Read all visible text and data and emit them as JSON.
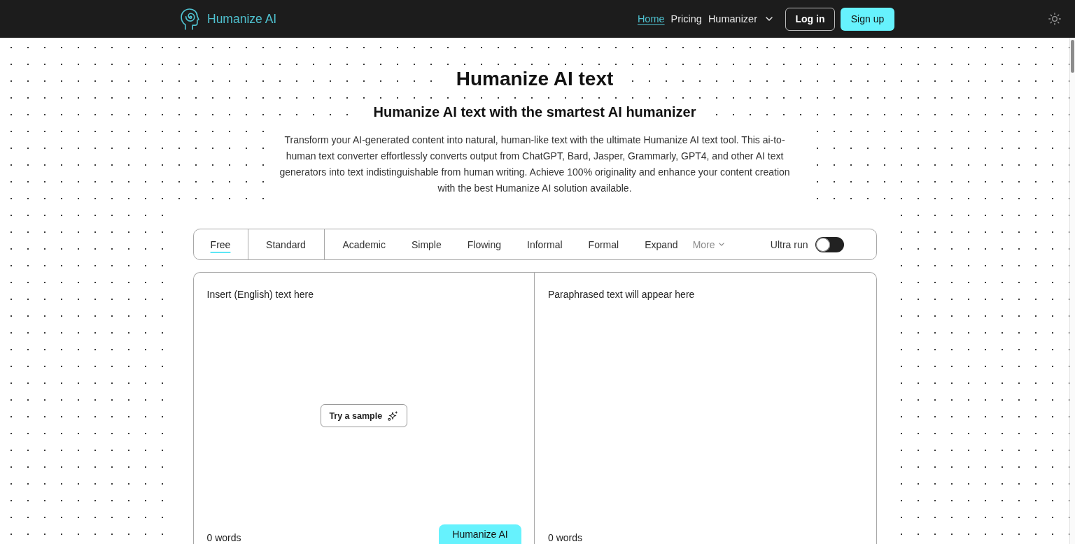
{
  "header": {
    "logo_text": "Humanize AI",
    "nav": [
      {
        "label": "Home",
        "kind": "link",
        "selected": true
      },
      {
        "label": "Pricing",
        "kind": "link",
        "selected": false
      },
      {
        "label": "Humanizer",
        "kind": "dropdown",
        "selected": false
      }
    ],
    "login": "Log in",
    "signup": "Sign up"
  },
  "hero": {
    "title": "Humanize AI text",
    "subtitle": "Humanize AI text with the smartest AI humanizer",
    "description": "Transform your AI-generated content into natural, human-like text with the ultimate Humanize AI text tool. This ai-to-human text converter effortlessly converts output from ChatGPT, Bard, Jasper, Grammarly, GPT4, and other AI text generators into text indistinguishable from human writing. Achieve 100% originality and enhance your content creation with the best Humanize AI solution available."
  },
  "modes": {
    "tiers": [
      {
        "label": "Free",
        "selected": true
      },
      {
        "label": "Standard",
        "selected": false
      }
    ],
    "styles": [
      {
        "label": "Academic",
        "selected": false
      },
      {
        "label": "Simple",
        "selected": false
      },
      {
        "label": "Flowing",
        "selected": false
      },
      {
        "label": "Informal",
        "selected": false
      },
      {
        "label": "Formal",
        "selected": false
      },
      {
        "label": "Expand",
        "selected": false
      }
    ],
    "more": "More",
    "ultra_run": {
      "label": "Ultra run",
      "on": false
    }
  },
  "editor": {
    "input": {
      "placeholder": "Insert (English) text here",
      "sample_button": "Try a sample",
      "word_count": "0 words",
      "submit_button": "Humanize AI"
    },
    "output": {
      "placeholder": "Paraphrased text will appear here",
      "word_count": "0 words"
    }
  }
}
